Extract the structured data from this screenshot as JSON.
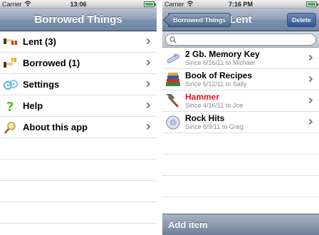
{
  "left": {
    "status": {
      "carrier": "Carrier",
      "time": "13:06"
    },
    "nav_title": "Borrowed Things",
    "menu": [
      {
        "label": "Lent (3)",
        "icon": "lent-icon"
      },
      {
        "label": "Borrowed (1)",
        "icon": "borrowed-icon"
      },
      {
        "label": "Settings",
        "icon": "settings-icon"
      },
      {
        "label": "Help",
        "icon": "help-icon"
      },
      {
        "label": "About this app",
        "icon": "about-icon"
      }
    ]
  },
  "right": {
    "status": {
      "carrier": "Carrier",
      "time": "7:16 PM"
    },
    "back_label": "Borrowed Things",
    "nav_title": "Lent",
    "delete_label": "Delete",
    "search_placeholder": "",
    "items": [
      {
        "name": "2 Gb. Memory Key",
        "sub": "Since 6/16/11 to Michael",
        "icon": "memory-key-icon",
        "highlight": false
      },
      {
        "name": "Book of Recipes",
        "sub": "Since 6/12/11 to Sally",
        "icon": "books-icon",
        "highlight": false
      },
      {
        "name": "Hammer",
        "sub": "Since 4/16/11 to Joe",
        "icon": "hammer-icon",
        "highlight": true
      },
      {
        "name": "Rock Hits",
        "sub": "Since 6/9/11 to Greg",
        "icon": "cd-icon",
        "highlight": false
      }
    ],
    "toolbar": {
      "add_label": "Add item"
    }
  },
  "colors": {
    "highlight_text": "#e0161b",
    "nav_blue": "#8d9fb8"
  }
}
